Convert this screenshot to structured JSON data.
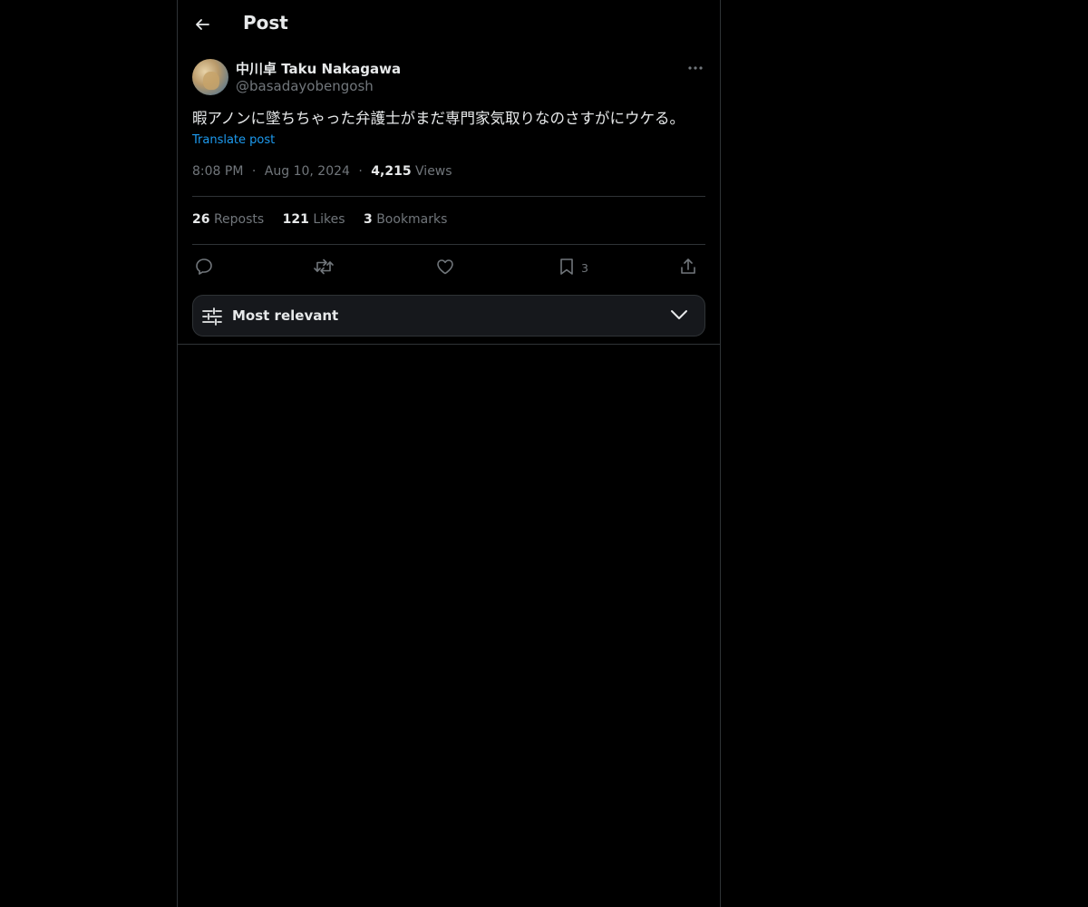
{
  "header": {
    "title": "Post",
    "back_icon": "arrow-left-icon"
  },
  "author": {
    "name": "中川卓 Taku Nakagawa",
    "handle": "@basadayobengosh"
  },
  "post": {
    "text": "暇アノンに墜ちちゃった弁護士がまだ専門家気取りなのさすがにウケる。",
    "translate_label": "Translate post",
    "time": "8:08 PM",
    "date": "Aug 10, 2024",
    "views_count": "4,215",
    "views_label": "Views",
    "separator": "·"
  },
  "stats": {
    "reposts_count": "26",
    "reposts_label": "Reposts",
    "likes_count": "121",
    "likes_label": "Likes",
    "bookmarks_count": "3",
    "bookmarks_label": "Bookmarks"
  },
  "actions": {
    "reply_icon": "reply-icon",
    "repost_icon": "repost-icon",
    "like_icon": "heart-icon",
    "bookmark_icon": "bookmark-icon",
    "bookmark_count": "3",
    "share_icon": "share-icon"
  },
  "sort": {
    "label": "Most relevant"
  },
  "colors": {
    "background": "#000000",
    "text": "#e7e9ea",
    "muted": "#71767b",
    "link": "#1d9bf0",
    "border": "#2f3336"
  }
}
